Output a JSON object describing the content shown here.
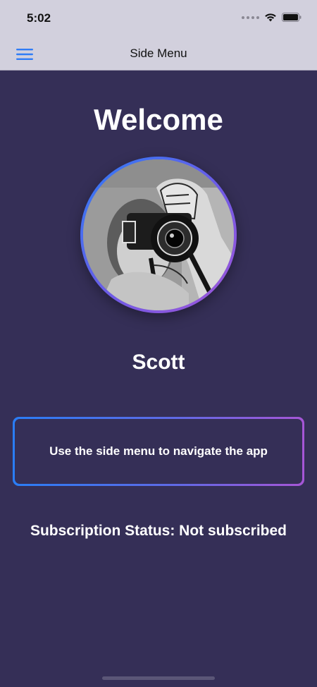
{
  "status_bar": {
    "time": "5:02",
    "icons": [
      "cellular-signal-icon",
      "wifi-icon",
      "battery-icon"
    ]
  },
  "nav_bar": {
    "title": "Side Menu",
    "menu_icon": "hamburger-menu-icon"
  },
  "main": {
    "welcome": "Welcome",
    "avatar_icon": "profile-photo",
    "user_name": "Scott",
    "hint": "Use the side menu to navigate the app",
    "subscription_status": "Subscription Status: Not subscribed"
  },
  "colors": {
    "background": "#352f57",
    "chrome": "#d2d0dd",
    "accent_blue": "#2c7cf6",
    "accent_purple": "#a356d8",
    "menu_icon": "#2f7cf6"
  }
}
